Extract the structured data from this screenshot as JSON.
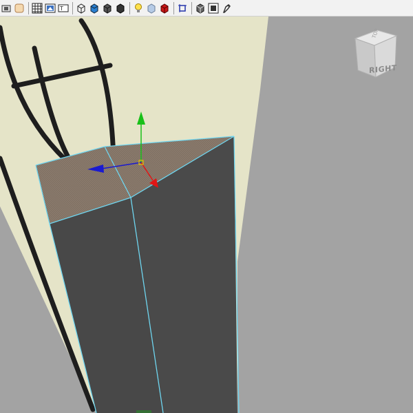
{
  "toolbar": {
    "buttons": [
      {
        "name": "select-camera-icon"
      },
      {
        "name": "image-plane-icon"
      },
      {
        "name": "grid-icon"
      },
      {
        "name": "film-gate-icon"
      },
      {
        "name": "resolution-gate-icon"
      },
      {
        "name": "wireframe-icon"
      },
      {
        "name": "smooth-shade-icon"
      },
      {
        "name": "flat-shade-icon"
      },
      {
        "name": "bounding-box-icon"
      },
      {
        "name": "light-icon"
      },
      {
        "name": "xray-icon"
      },
      {
        "name": "textured-icon"
      },
      {
        "name": "isolate-select-icon"
      },
      {
        "name": "xray-joints-icon"
      },
      {
        "name": "frame-all-icon"
      },
      {
        "name": "render-icon"
      }
    ]
  },
  "viewport": {
    "background_color": "#a3a3a3",
    "cream_plane_color": "#e5e4c8",
    "object_color": "#4a4a4a",
    "selection_edge_color": "#6fd6f0",
    "manipulator": {
      "y_axis_color": "#19c019",
      "x_axis_color": "#e01515",
      "z_axis_color": "#1a1ad0"
    }
  },
  "viewcube": {
    "face_label": "RIGHT"
  }
}
